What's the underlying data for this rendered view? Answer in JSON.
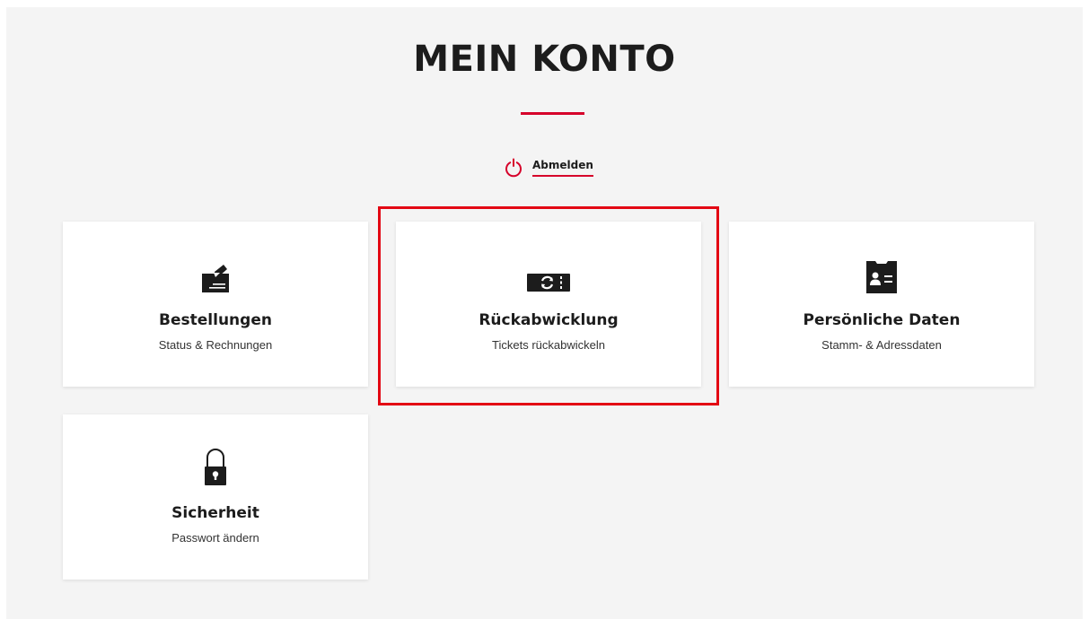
{
  "header": {
    "title": "MEIN KONTO"
  },
  "logout": {
    "label": "Abmelden",
    "icon": "power-icon"
  },
  "cards": [
    {
      "title": "Bestellungen",
      "subtitle": "Status & Rechnungen",
      "icon": "order-edit-icon"
    },
    {
      "title": "Rückabwicklung",
      "subtitle": "Tickets rückabwickeln",
      "icon": "ticket-refund-icon"
    },
    {
      "title": "Persönliche Daten",
      "subtitle": "Stamm- & Adressdaten",
      "icon": "id-card-icon"
    },
    {
      "title": "Sicherheit",
      "subtitle": "Passwort ändern",
      "icon": "padlock-icon"
    }
  ],
  "colors": {
    "accent": "#d6002a",
    "highlight": "#e30613",
    "background": "#f4f4f4",
    "card": "#ffffff",
    "text": "#1c1c1c"
  }
}
